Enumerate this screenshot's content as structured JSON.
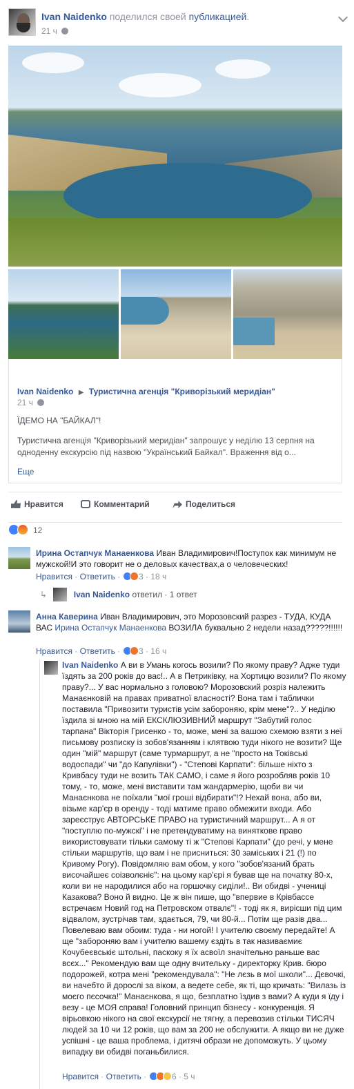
{
  "post": {
    "author": "Ivan Naidenko",
    "shared_verb": "поделился своей",
    "shared_link": "публикацией",
    "time": "21 ч"
  },
  "shared": {
    "author": "Ivan Naidenko",
    "page": "Туристична агенція \"Криворізький меридіан\"",
    "time": "21 ч",
    "headline": "ЇДЕМО НА \"БАЙКАЛ\"!",
    "body": "Туристична агенція \"Криворізький меридіан\" запрошує у неділю 13 серпня на одноденну екскурсію під назвою \"Український Байкал\". Враження від о...",
    "more": "Еще"
  },
  "actions": {
    "like": "Нравится",
    "comment": "Комментарий",
    "share": "Поделиться"
  },
  "reactions": {
    "count": "12"
  },
  "comments": [
    {
      "name": "Ирина Остапчук Манаенкова",
      "text": "Иван Владимирович!Поступок как минимум не мужской!И это говорит не о деловых качествах,а о человеческих!",
      "like": "Нравится",
      "reply": "Ответить",
      "count": "3",
      "time": "18 ч",
      "reply_summary": {
        "name": "Ivan Naidenko",
        "verb": "ответил",
        "count": "1 ответ"
      }
    },
    {
      "name": "Анна Каверина",
      "text_pre": "Иван Владимирович, это Морозовский разрез - ТУДА, КУДА ВАС",
      "mention": "Ирина Остапчук Манаенкова",
      "text_post": "ВОЗИЛА буквально 2 недели назад?????!!!!!!",
      "like": "Нравится",
      "reply": "Ответить",
      "count": "3",
      "time": "16 ч"
    }
  ],
  "reply": {
    "name": "Ivan Naidenko",
    "text": "А ви в Умань когось возили? По якому праву? Адже туди їздять за 200 років до вас!.. А в Петриківку, на Хортицю возили? По якому праву?... У вас нормально з головою? Морозовский розріз належить Манаєнковій на правах приватної власності? Вона там і таблички поставила \"Привозити туристів усім забороняю, крім мене\"?.. У неділю їздила зі мною на мій ЕКСКЛЮЗИВНИЙ маршрут \"Забутий голос тарпана\" Вікторія Грисенко - то, може, мені за вашою схемою взяти з неї письмову розписку із зобов'язанням і клятвою туди нікого не возити? Ще один \"мій\" маршрут (саме турмаршрут, а не \"просто на Токівські водоспади\" чи \"до Капулівки\") - \"Степові Карпати\": більше ніхто з Кривбасу туди не возить ТАК САМО, і саме я його розробляв років 10 тому, - то, може, мені виставити там жандармерію, щоби ви чи Манаєнкова не поїхали \"мої гроші відбирати\"!? Нехай вона, або ви, візьме кар'єр в оренду - тоді матиме право обмежити входи. Або зареєструє АВТОРСЬКЕ ПРАВО на туристичний маршрут... А я от \"поступлю по-мужскі\" і не претендуватиму на виняткове право використовувати тільки самому ті ж \"Степові Карпати\" (до речі, у мене стільки маршрутів, що вам і не присниться: 30 заміських і 21 (!) по Кривому Рогу). Повідомляю вам обом, у кого \"зобов'язаний брать височайшеє соізволєніє\": на цьому кар'єрі я бував ще на початку 80-х, коли ви не народилися або на горшочку сиділи!.. Ви обидві - учениці Казакова? Воно й видно. Це ж він пише, що \"впервие в Крівбассе встречаєм Новий год на Петровском отвалє\"! - тоді як я, вирісши під цим відвалом, зустрічав там, здається, 79, чи 80-й... Потім ще разів два... Повелеваю вам обоим: туда - ни ногой! І учителю своєму передайте! А ще \"забороняю вам і учителю вашему єздіть в так називаємиє Кочубеєвськіє штольні, паскоку я їх асвоїл значітельно раньше вас всєх...\" Рекомендую вам ще одну вчительку - директорку Крив. бюро подорожей, котра мені \"рекомендувала\": \"Не лєзь в мої школи\"... Дєвочкі, ви начебто й дорослі за віком, а ведете себе, як ті, що кричать: \"Вилазь із моєго пєсочка!\" Манаєнкова, я що, безплатно їздив з вами? А куди я їду і везу - це МОЯ справа! Головний принцип бізнесу - конкуренція. Я вірьовкою нікого на свої екскурсії не тягну, а перевозив стільки ТИСЯЧ людей за 10 чи 12 років, що вам за 200 не обслужити. А якщо ви не дуже успішні - це ваша проблема, і дитячі образи не допоможуть. У цьому випадку ви обидві поганьбилися.",
    "like": "Нравится",
    "reply_btn": "Ответить",
    "count": "6",
    "time": "5 ч"
  }
}
